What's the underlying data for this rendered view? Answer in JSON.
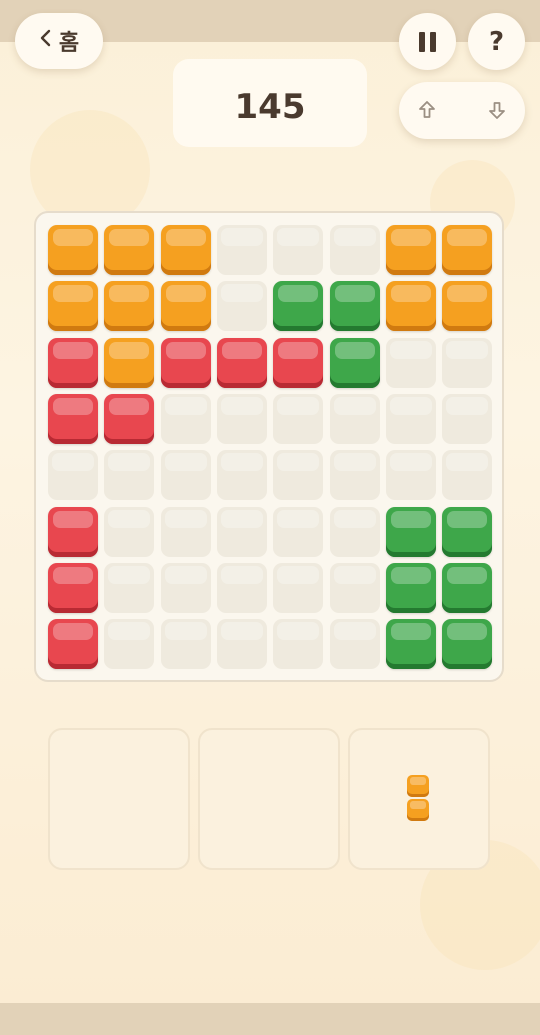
{
  "header": {
    "back_label": "홈",
    "score": "145"
  },
  "icons": {
    "back": "chevron-left-icon",
    "pause": "pause-icon",
    "help": "question-icon",
    "up": "arrow-up-icon",
    "down": "arrow-down-icon"
  },
  "help_label": "?",
  "colors": {
    "orange": "#f5a020",
    "red": "#e8474f",
    "green": "#3ea74a",
    "empty": "#efeade",
    "text": "#4a3a2e"
  },
  "board": {
    "rows": 8,
    "cols": 8,
    "cells": [
      [
        "orange",
        "orange",
        "orange",
        "empty",
        "empty",
        "empty",
        "orange",
        "orange"
      ],
      [
        "orange",
        "orange",
        "orange",
        "empty",
        "green",
        "green",
        "orange",
        "orange"
      ],
      [
        "red",
        "orange",
        "red",
        "red",
        "red",
        "green",
        "empty",
        "empty"
      ],
      [
        "red",
        "red",
        "empty",
        "empty",
        "empty",
        "empty",
        "empty",
        "empty"
      ],
      [
        "empty",
        "empty",
        "empty",
        "empty",
        "empty",
        "empty",
        "empty",
        "empty"
      ],
      [
        "red",
        "empty",
        "empty",
        "empty",
        "empty",
        "empty",
        "green",
        "green"
      ],
      [
        "red",
        "empty",
        "empty",
        "empty",
        "empty",
        "empty",
        "green",
        "green"
      ],
      [
        "red",
        "empty",
        "empty",
        "empty",
        "empty",
        "empty",
        "green",
        "green"
      ]
    ]
  },
  "trays": [
    {
      "piece": null
    },
    {
      "piece": null
    },
    {
      "piece": {
        "color": "orange",
        "shape": [
          [
            1
          ],
          [
            1
          ]
        ]
      }
    }
  ]
}
